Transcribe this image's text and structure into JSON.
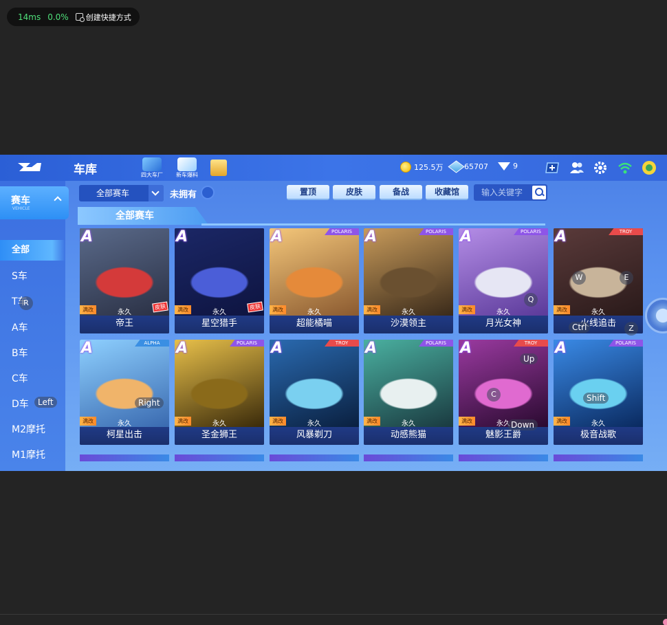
{
  "overlay_stats": {
    "latency": "14ms",
    "loss": "0.0%",
    "shortcut_label": "创建快捷方式"
  },
  "topbar": {
    "title": "车库",
    "icons": [
      {
        "name": "four-factories",
        "label": "四大车厂"
      },
      {
        "name": "new-car-news",
        "label": "新车爆料"
      }
    ],
    "coins": "125.5万",
    "gems": "65707",
    "diamonds": "9"
  },
  "sidebar": {
    "header": "赛车",
    "header_sub": "VEHICLE",
    "items": [
      "全部",
      "S车",
      "T车",
      "A车",
      "B车",
      "C车",
      "D车",
      "M2摩托",
      "M1摩托"
    ],
    "active_index": 0
  },
  "filters": {
    "dropdown_value": "全部赛车",
    "unowned_label": "未拥有",
    "buttons": [
      "置顶",
      "皮肤",
      "备战",
      "收藏馆"
    ],
    "search_placeholder": "输入关键字"
  },
  "section_title": "全部赛车",
  "cars": [
    {
      "name": "帝王",
      "grade": "A",
      "tag": "满改",
      "status": "永久",
      "skin": "皮肤",
      "brand": "",
      "colors": [
        "#5a6a8a",
        "#d43a3a",
        "#2a3044"
      ]
    },
    {
      "name": "星空猎手",
      "grade": "A",
      "tag": "满改",
      "status": "永久",
      "skin": "皮肤",
      "brand": "",
      "colors": [
        "#1b2766",
        "#4b5ed8",
        "#0e1440"
      ]
    },
    {
      "name": "超能橘喵",
      "grade": "A",
      "tag": "满改",
      "status": "永久",
      "skin": "",
      "brand": "POLARIS",
      "colors": [
        "#f4c77a",
        "#e58a3a",
        "#8b5a30"
      ]
    },
    {
      "name": "沙漠领主",
      "grade": "A",
      "tag": "满改",
      "status": "永久",
      "skin": "",
      "brand": "POLARIS",
      "colors": [
        "#c79a5a",
        "#6a5030",
        "#3a2a1a"
      ]
    },
    {
      "name": "月光女神",
      "grade": "A",
      "tag": "满改",
      "status": "永久",
      "skin": "",
      "brand": "POLARIS",
      "colors": [
        "#b48de6",
        "#e6e6f4",
        "#5b3a9a"
      ]
    },
    {
      "name": "火线追击",
      "grade": "A",
      "tag": "满改",
      "status": "永久",
      "skin": "",
      "brand": "TROY",
      "colors": [
        "#5a3a3a",
        "#c8b49a",
        "#2a1a1a"
      ]
    },
    {
      "name": "柯星出击",
      "grade": "A",
      "tag": "满改",
      "status": "永久",
      "skin": "",
      "brand": "ALPHA",
      "colors": [
        "#8ed0ff",
        "#f0b46a",
        "#3a6ab0"
      ]
    },
    {
      "name": "圣金狮王",
      "grade": "A",
      "tag": "满改",
      "status": "永久",
      "skin": "",
      "brand": "POLARIS",
      "colors": [
        "#e8c04a",
        "#8a6a1a",
        "#3a2a0a"
      ]
    },
    {
      "name": "风暴剃刀",
      "grade": "A",
      "tag": "满改",
      "status": "永久",
      "skin": "",
      "brand": "TROY",
      "colors": [
        "#2a6ab0",
        "#7ad0f0",
        "#0a2040"
      ]
    },
    {
      "name": "动感熊猫",
      "grade": "A",
      "tag": "满改",
      "status": "永久",
      "skin": "",
      "brand": "POLARIS",
      "colors": [
        "#4ab0a0",
        "#e8f0f0",
        "#1a3a40"
      ]
    },
    {
      "name": "魅影王爵",
      "grade": "A",
      "tag": "满改",
      "status": "永久",
      "skin": "",
      "brand": "TROY",
      "colors": [
        "#9a3aa0",
        "#e06ad0",
        "#2a0a30"
      ]
    },
    {
      "name": "极音战歌",
      "grade": "A",
      "tag": "满改",
      "status": "永久",
      "skin": "",
      "brand": "POLARIS",
      "colors": [
        "#3a8ae6",
        "#6ad0f0",
        "#0a2a60"
      ]
    }
  ],
  "key_overlays": {
    "r": "R",
    "left": "Left",
    "right": "Right",
    "q": "Q",
    "w": "W",
    "e": "E",
    "ctrl": "Ctrl",
    "z": "Z",
    "up": "Up",
    "c": "C",
    "down": "Down",
    "shift": "Shift"
  }
}
